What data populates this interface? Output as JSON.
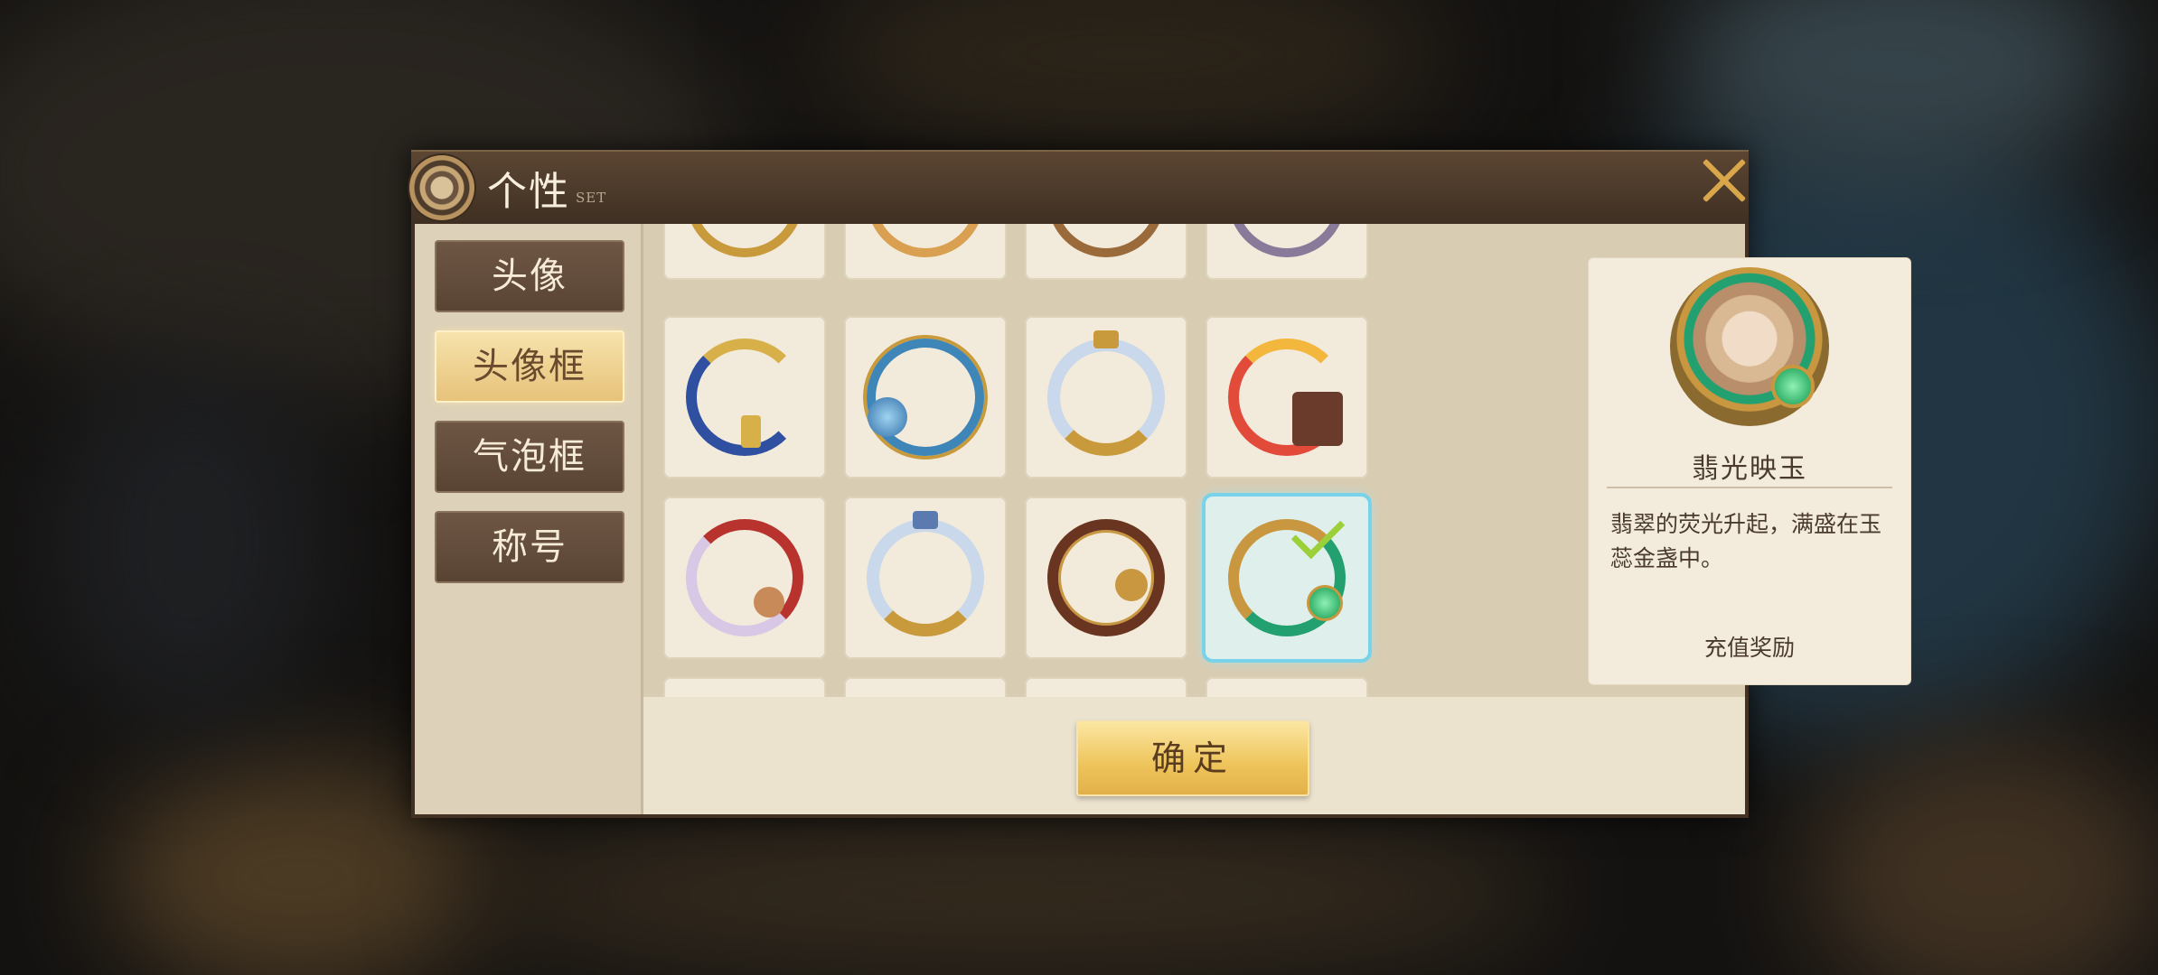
{
  "dialog": {
    "title": "个性",
    "subtitle": "SET"
  },
  "tabs": [
    {
      "label": "头像",
      "active": false
    },
    {
      "label": "头像框",
      "active": true
    },
    {
      "label": "气泡框",
      "active": false
    },
    {
      "label": "称号",
      "active": false
    }
  ],
  "frames": [
    {
      "name": "moon-hourglass-frame",
      "primary": "#2f4fa0",
      "accent": "#d8b04a",
      "selected": false
    },
    {
      "name": "blue-globe-frame",
      "primary": "#3f86b8",
      "accent": "#c99a3c",
      "selected": false
    },
    {
      "name": "angel-wings-frame",
      "primary": "#c9d8ea",
      "accent": "#c99a3c",
      "selected": false
    },
    {
      "name": "lantern-pagoda-frame",
      "primary": "#e24a3a",
      "accent": "#f2b73c",
      "selected": false
    },
    {
      "name": "rose-feather-frame",
      "primary": "#b8322e",
      "accent": "#d8c8e6",
      "selected": false
    },
    {
      "name": "angel-wings-frame-2",
      "primary": "#c9d8ea",
      "accent": "#c99a3c",
      "selected": false
    },
    {
      "name": "bronze-ornate-frame",
      "primary": "#6a3520",
      "accent": "#c9973f",
      "selected": false
    },
    {
      "name": "jade-gold-frame",
      "primary": "#22a070",
      "accent": "#c9973f",
      "selected": true
    }
  ],
  "detail": {
    "name": "翡光映玉",
    "description": "翡翠的荧光升起，满盛在玉蕊金盏中。",
    "source": "充值奖励"
  },
  "confirm_label": "确定",
  "colors": {
    "accent_gold": "#d9a64a",
    "selected_glow": "#77d2ea",
    "panel_bg": "#ece3cf"
  }
}
